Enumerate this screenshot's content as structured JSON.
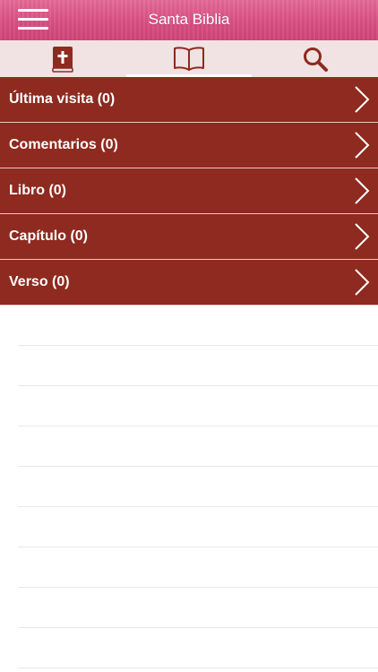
{
  "header": {
    "title": "Santa Biblia",
    "menu_icon": "hamburger-menu-icon"
  },
  "tabs": [
    {
      "icon": "bible-book-icon",
      "active": false
    },
    {
      "icon": "open-book-icon",
      "active": true
    },
    {
      "icon": "search-icon",
      "active": false
    }
  ],
  "list": {
    "items": [
      {
        "label": "Última visita (0)"
      },
      {
        "label": "Comentarios (0)"
      },
      {
        "label": "Libro (0)"
      },
      {
        "label": "Capítulo (0)"
      },
      {
        "label": "Verso (0)"
      }
    ],
    "chevron_icon": "chevron-right-icon"
  },
  "colors": {
    "header_pink": "#d95083",
    "tabbar_background": "#f1e2e3",
    "row_background": "#8e2a1f",
    "icon_color": "#8e2a1f",
    "text_white": "#ffffff"
  }
}
